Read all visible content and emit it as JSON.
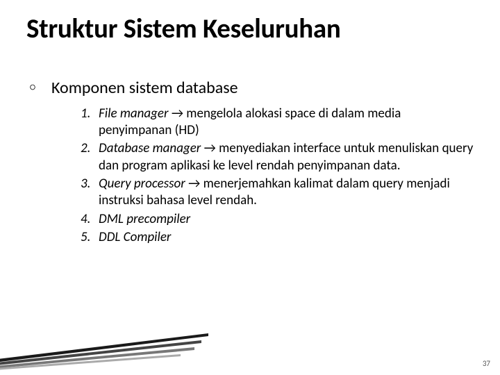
{
  "title": "Struktur Sistem Keseluruhan",
  "subhead": "Komponen sistem database",
  "items": [
    {
      "num": "1.",
      "term": "File manager ",
      "arrow": "→",
      "desc": " mengelola alokasi space di dalam media penyimpanan (HD)"
    },
    {
      "num": "2.",
      "term": "Database manager ",
      "arrow": "→",
      "desc": " menyediakan interface untuk menuliskan query dan program aplikasi ke level rendah penyimpanan data."
    },
    {
      "num": "3.",
      "term": "Query processor ",
      "arrow": "→",
      "desc": " menerjemahkan kalimat dalam query menjadi instruksi bahasa level rendah."
    },
    {
      "num": "4.",
      "term": "DML precompiler",
      "arrow": "",
      "desc": ""
    },
    {
      "num": "5.",
      "term": "DDL Compiler",
      "arrow": "",
      "desc": ""
    }
  ],
  "page_number": "37"
}
